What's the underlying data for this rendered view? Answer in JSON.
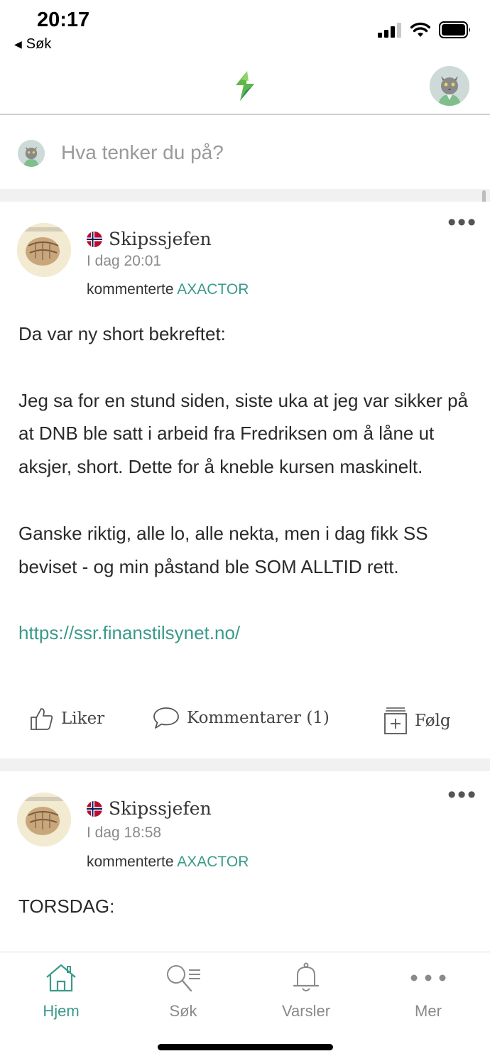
{
  "status_bar": {
    "time": "20:17",
    "back_label": "Søk"
  },
  "header": {
    "logo": "app-logo-icon",
    "avatar": "cat-avatar"
  },
  "composer": {
    "placeholder": "Hva tenker du på?"
  },
  "posts": [
    {
      "author": "Skipssjefen",
      "time": "I dag 20:01",
      "action_prefix": "kommenterte",
      "ticker": "AXACTOR",
      "paragraphs": [
        "Da var ny short bekreftet:",
        "",
        "Jeg sa for en stund siden, siste uka at jeg var sikker på at DNB ble satt i arbeid fra Fredriksen om å låne ut aksjer, short. Dette for å kneble kursen maskinelt.",
        "",
        "Ganske riktig, alle lo, alle nekta, men i dag fikk SS beviset - og min påstand ble SOM ALLTID rett.",
        ""
      ],
      "link": "https://ssr.finanstilsynet.no/",
      "actions": {
        "like": "Liker",
        "comments": "Kommentarer (1)",
        "follow": "Følg"
      }
    },
    {
      "author": "Skipssjefen",
      "time": "I dag 18:58",
      "action_prefix": "kommenterte",
      "ticker": "AXACTOR",
      "paragraphs": [
        "TORSDAG:"
      ]
    }
  ],
  "tabs": [
    {
      "label": "Hjem",
      "icon": "home-icon",
      "active": true
    },
    {
      "label": "Søk",
      "icon": "search-list-icon",
      "active": false
    },
    {
      "label": "Varsler",
      "icon": "bell-icon",
      "active": false
    },
    {
      "label": "Mer",
      "icon": "more-dots-icon",
      "active": false
    }
  ],
  "colors": {
    "accent": "#3a9a8a",
    "text": "#2a2a2a",
    "muted": "#8a8a8a"
  }
}
